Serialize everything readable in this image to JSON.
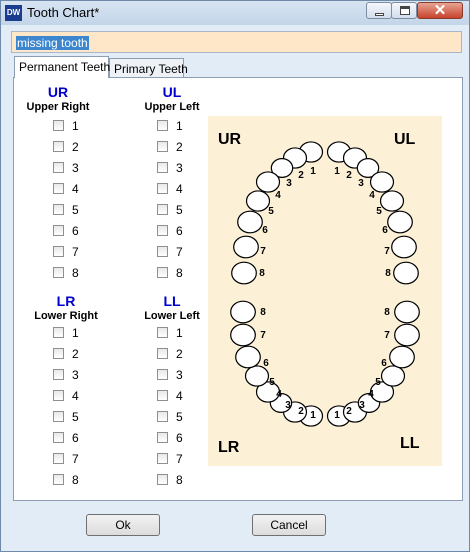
{
  "window": {
    "title": "Tooth Chart*",
    "app_icon_text": "DW"
  },
  "note_field": {
    "value": "missing tooth"
  },
  "tabs": [
    {
      "label": "Permanent Teeth",
      "active": true
    },
    {
      "label": "Primary Teeth",
      "active": false
    }
  ],
  "quadrants": [
    {
      "id": "ur",
      "code": "UR",
      "name": "Upper Right",
      "teeth": [
        "1",
        "2",
        "3",
        "4",
        "5",
        "6",
        "7",
        "8"
      ]
    },
    {
      "id": "ul",
      "code": "UL",
      "name": "Upper Left",
      "teeth": [
        "1",
        "2",
        "3",
        "4",
        "5",
        "6",
        "7",
        "8"
      ]
    },
    {
      "id": "lr",
      "code": "LR",
      "name": "Lower Right",
      "teeth": [
        "1",
        "2",
        "3",
        "4",
        "5",
        "6",
        "7",
        "8"
      ]
    },
    {
      "id": "ll",
      "code": "LL",
      "name": "Lower Left",
      "teeth": [
        "1",
        "2",
        "3",
        "4",
        "5",
        "6",
        "7",
        "8"
      ]
    }
  ],
  "diagram": {
    "corner_labels": {
      "ur": "UR",
      "ul": "UL",
      "lr": "LR",
      "ll": "LL"
    }
  },
  "buttons": {
    "ok": "Ok",
    "cancel": "Cancel"
  },
  "colors": {
    "quadrant_code": "#0000cc",
    "diagram_bg": "#fcf1d6",
    "selection": "#3b86ce"
  }
}
